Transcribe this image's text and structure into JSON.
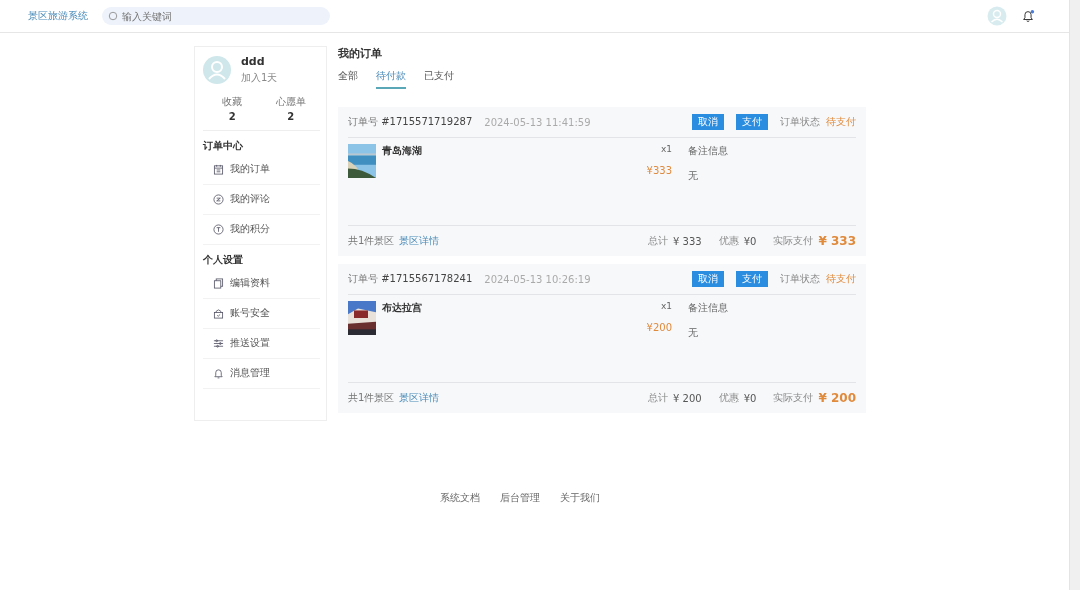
{
  "header": {
    "logo": "景区旅游系统",
    "search": {
      "placeholder": "输入关键词"
    },
    "notification": {
      "unread": true
    }
  },
  "profile": {
    "name": "ddd",
    "joined": "加入1天",
    "stats": [
      {
        "label": "收藏",
        "value": "2"
      },
      {
        "label": "心愿单",
        "value": "2"
      }
    ]
  },
  "menu_sections": [
    {
      "title": "订单中心",
      "items": [
        {
          "label": "我的订单"
        },
        {
          "label": "我的评论"
        },
        {
          "label": "我的积分"
        }
      ]
    },
    {
      "title": "个人设置",
      "items": [
        {
          "label": "编辑资料"
        },
        {
          "label": "账号安全"
        },
        {
          "label": "推送设置"
        },
        {
          "label": "消息管理"
        }
      ]
    }
  ],
  "page_title": "我的订单",
  "tabs": [
    {
      "label": "全部",
      "selected": false
    },
    {
      "label": "待付款",
      "selected": true
    },
    {
      "label": "已支付",
      "selected": false
    }
  ],
  "orders": [
    {
      "number_label": "订单号",
      "number": "#1715571719287",
      "time": "2024-05-13 11:41:59",
      "buttons": [
        "取消",
        "支付"
      ],
      "status_label": "订单状态",
      "status": "待支付",
      "item": {
        "name": "青岛海湖",
        "qty": "x1",
        "price": "¥333",
        "remark_label": "备注信息",
        "remark": "无"
      },
      "count_text": "共1件景区",
      "detail_link": "景区详情",
      "total_label": "总计",
      "total": "¥ 333",
      "discount_label": "优惠",
      "discount": "¥0",
      "paid_label": "实际支付",
      "paid": "¥ 333"
    },
    {
      "number_label": "订单号",
      "number": "#1715567178241",
      "time": "2024-05-13 10:26:19",
      "buttons": [
        "取消",
        "支付"
      ],
      "status_label": "订单状态",
      "status": "待支付",
      "item": {
        "name": "布达拉宫",
        "qty": "x1",
        "price": "¥200",
        "remark_label": "备注信息",
        "remark": "无"
      },
      "count_text": "共1件景区",
      "detail_link": "景区详情",
      "total_label": "总计",
      "total": "¥ 200",
      "discount_label": "优惠",
      "discount": "¥0",
      "paid_label": "实际支付",
      "paid": "¥ 200"
    }
  ],
  "footer_links": [
    "系统文档",
    "后台管理",
    "关于我们"
  ]
}
